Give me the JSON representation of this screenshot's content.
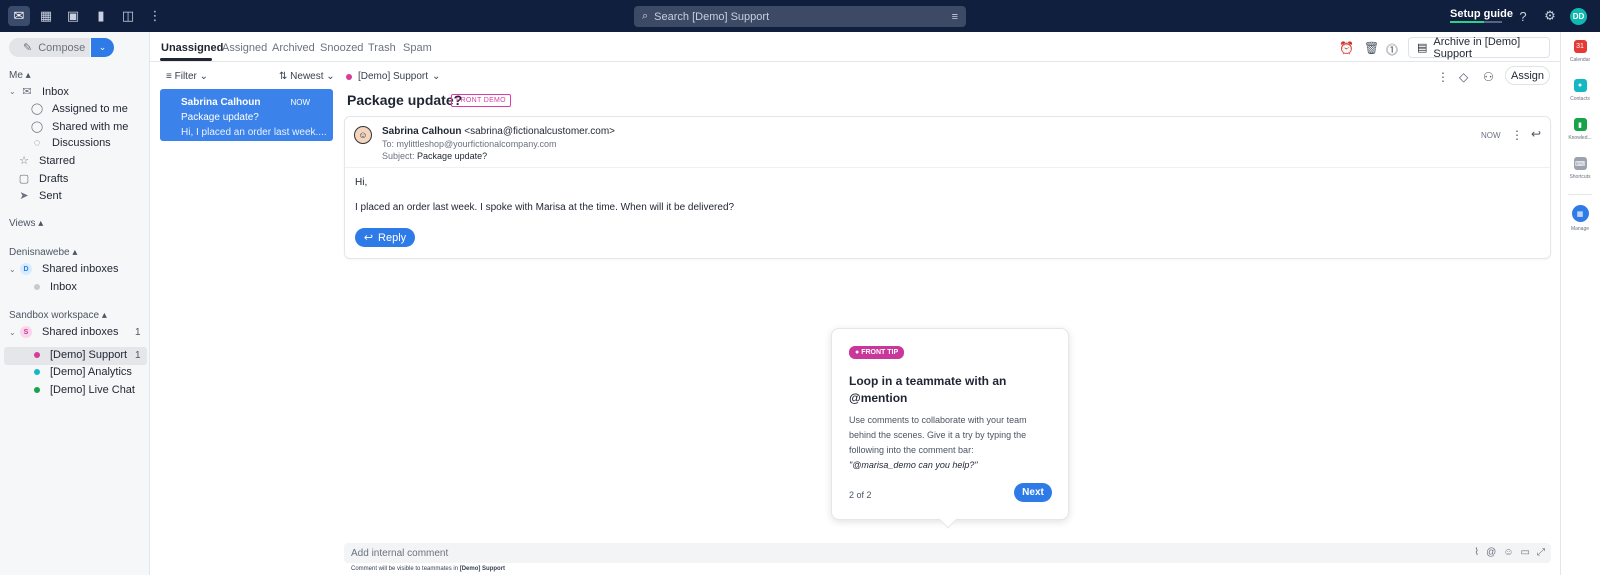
{
  "topbar": {
    "search_placeholder": "Search [Demo] Support",
    "setup_guide": "Setup guide",
    "avatar_initials": "DD"
  },
  "sidebar": {
    "compose": "Compose",
    "me_section": "Me",
    "inbox": "Inbox",
    "assigned_to_me": "Assigned to me",
    "shared_with_me": "Shared with me",
    "discussions": "Discussions",
    "starred": "Starred",
    "drafts": "Drafts",
    "sent": "Sent",
    "views_section": "Views",
    "workspace1": "Denisnawebe",
    "shared_inboxes_1": "Shared inboxes",
    "shared_inboxes_1_badge": "D",
    "workspace1_inbox": "Inbox",
    "workspace2": "Sandbox workspace",
    "shared_inboxes_2": "Shared inboxes",
    "shared_inboxes_2_badge": "S",
    "shared_inboxes_2_count": "1",
    "demo_support": "[Demo] Support",
    "demo_support_count": "1",
    "demo_analytics": "[Demo] Analytics",
    "demo_live_chat": "[Demo] Live Chat"
  },
  "tabs": [
    "Unassigned",
    "Assigned",
    "Archived",
    "Snoozed",
    "Trash",
    "Spam"
  ],
  "archive_button": "Archive in [Demo] Support",
  "list": {
    "filter": "Filter",
    "sort": "Newest",
    "conversation": {
      "name": "Sabrina Calhoun",
      "time": "NOW",
      "subject": "Package update?",
      "preview": "Hi, I placed an order last week...."
    }
  },
  "thread": {
    "inbox": "[Demo] Support",
    "title": "Package update?",
    "tag": "FRONT DEMO",
    "assign": "Assign",
    "message": {
      "from_name": "Sabrina Calhoun",
      "from_email": "<sabrina@fictionalcustomer.com>",
      "to": "To: mylittleshop@yourfictionalcompany.com",
      "subject_label": "Subject:",
      "subject": "Package update?",
      "time": "NOW",
      "body_greeting": "Hi,",
      "body_text": "I placed an order last week. I spoke with Marisa at the time. When will it be delivered?",
      "reply": "Reply"
    }
  },
  "tip": {
    "badge": "FRONT TIP",
    "title": "Loop in a teammate with an @mention",
    "body": "Use comments to collaborate with your team behind the scenes. Give it a try by typing the following into the comment bar:",
    "example": "\"@marisa_demo can you help?\"",
    "page": "2 of 2",
    "next": "Next"
  },
  "comment": {
    "placeholder": "Add internal comment",
    "note_prefix": "Comment will be visible to teammates in",
    "note_inbox": "[Demo] Support"
  },
  "rail": {
    "calendar": "Calendar",
    "calendar_num": "31",
    "contacts": "Contacts",
    "knowledge": "Knowled...",
    "shortcuts": "Shortcuts",
    "manage": "Manage"
  },
  "colors": {
    "topbar": "#0f1f3d",
    "accent_blue": "#2e7be8",
    "demo_pink": "#d63ea8",
    "support_dot": "#d63e94",
    "analytics_dot": "#14b8c4",
    "livechat_dot": "#16a34a"
  }
}
